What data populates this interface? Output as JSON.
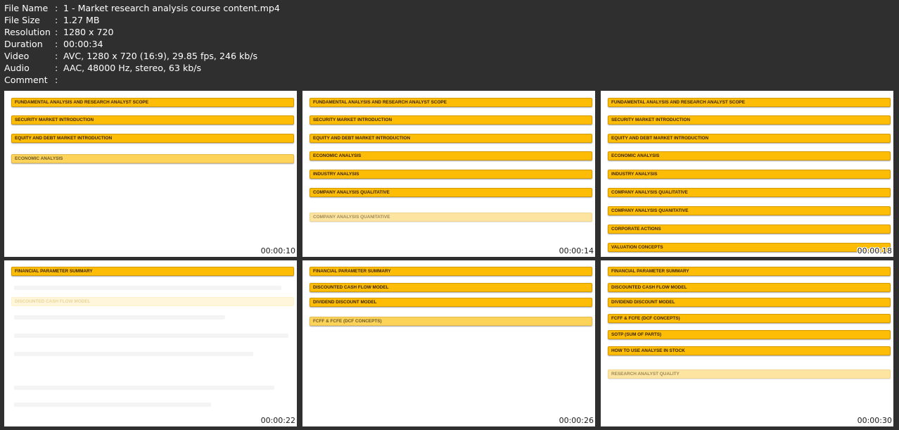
{
  "file_info": {
    "rows": [
      {
        "key": "File Name",
        "value": "1 - Market research analysis course content.mp4"
      },
      {
        "key": "File Size",
        "value": "1.27 MB"
      },
      {
        "key": "Resolution",
        "value": "1280 x 720"
      },
      {
        "key": "Duration",
        "value": "00:00:34"
      },
      {
        "key": "Video",
        "value": "AVC, 1280 x 720 (16:9), 29.85 fps, 246 kb/s"
      },
      {
        "key": "Audio",
        "value": "AAC, 48000 Hz, stereo, 63 kb/s"
      },
      {
        "key": "Comment",
        "value": ""
      }
    ],
    "separator": ":"
  },
  "thumbnails": [
    {
      "timestamp": "00:00:10",
      "items": [
        {
          "label": "FUNDAMENTAL ANALYSIS AND RESEARCH ANALYST SCOPE",
          "state": "solid"
        },
        {
          "label": "SECURITY MARKET INTRODUCTION",
          "state": "solid"
        },
        {
          "label": "EQUITY AND DEBT MARKET INTRODUCTION",
          "state": "solid"
        },
        {
          "label": "ECONOMIC ANALYSIS",
          "state": "fading"
        }
      ]
    },
    {
      "timestamp": "00:00:14",
      "items": [
        {
          "label": "FUNDAMENTAL ANALYSIS AND RESEARCH ANALYST SCOPE",
          "state": "solid"
        },
        {
          "label": "SECURITY MARKET INTRODUCTION",
          "state": "solid"
        },
        {
          "label": "EQUITY AND DEBT MARKET INTRODUCTION",
          "state": "solid"
        },
        {
          "label": "ECONOMIC ANALYSIS",
          "state": "solid"
        },
        {
          "label": "INDUSTRY ANALYSIS",
          "state": "solid"
        },
        {
          "label": "COMPANY ANALYSIS QUALITATIVE",
          "state": "solid"
        },
        {
          "label": "COMPANY ANALYSIS QUANITATIVE",
          "state": "fading-strong"
        }
      ]
    },
    {
      "timestamp": "00:00:18",
      "items": [
        {
          "label": "FUNDAMENTAL ANALYSIS AND RESEARCH ANALYST SCOPE",
          "state": "solid"
        },
        {
          "label": "SECURITY MARKET INTRODUCTION",
          "state": "solid"
        },
        {
          "label": "EQUITY AND DEBT MARKET INTRODUCTION",
          "state": "solid"
        },
        {
          "label": "ECONOMIC ANALYSIS",
          "state": "solid"
        },
        {
          "label": "INDUSTRY ANALYSIS",
          "state": "solid"
        },
        {
          "label": "COMPANY ANALYSIS QUALITATIVE",
          "state": "solid"
        },
        {
          "label": "COMPANY ANALYSIS QUANITATIVE",
          "state": "solid"
        },
        {
          "label": "CORPORATE ACTIONS",
          "state": "solid"
        },
        {
          "label": "VALUATION CONCEPTS",
          "state": "solid"
        }
      ]
    },
    {
      "timestamp": "00:00:22",
      "items": [
        {
          "label": "FINANCIAL PARAMETER SUMMARY",
          "state": "solid"
        },
        {
          "label": "DISCOUNTED CASH FLOW MODEL",
          "state": "ghost"
        }
      ]
    },
    {
      "timestamp": "00:00:26",
      "items": [
        {
          "label": "FINANCIAL PARAMETER SUMMARY",
          "state": "solid"
        },
        {
          "label": "DISCOUNTED CASH FLOW MODEL",
          "state": "solid"
        },
        {
          "label": "DIVIDEND DISCOUNT MODEL",
          "state": "solid"
        },
        {
          "label": "FCFF & FCFE (DCF CONCEPTS)",
          "state": "fading"
        }
      ]
    },
    {
      "timestamp": "00:00:30",
      "items": [
        {
          "label": "FINANCIAL PARAMETER SUMMARY",
          "state": "solid"
        },
        {
          "label": "DISCOUNTED CASH FLOW MODEL",
          "state": "solid"
        },
        {
          "label": "DIVIDEND DISCOUNT MODEL",
          "state": "solid"
        },
        {
          "label": "FCFF & FCFE (DCF CONCEPTS)",
          "state": "solid"
        },
        {
          "label": "SOTP (SUM OF PARTS)",
          "state": "solid"
        },
        {
          "label": "HOW TO USE ANALYSE IN STOCK",
          "state": "solid"
        },
        {
          "label": "RESEARCH ANALYST QUALITY",
          "state": "fading-strong"
        }
      ]
    }
  ]
}
